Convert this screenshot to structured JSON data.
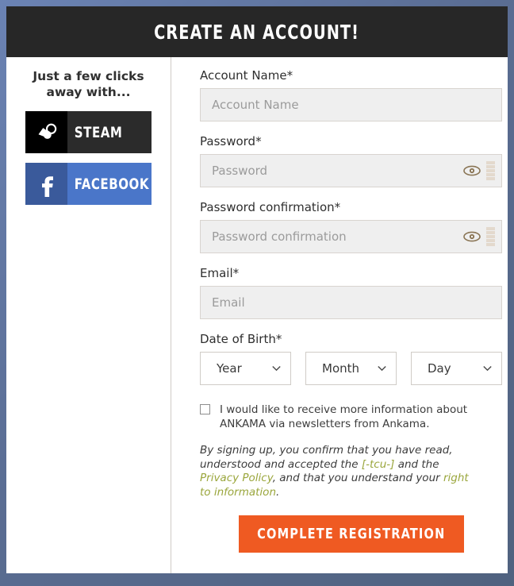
{
  "header": {
    "title": "CREATE AN ACCOUNT!"
  },
  "sidebar": {
    "heading": "Just a few clicks away with...",
    "buttons": [
      {
        "label": "STEAM",
        "icon": "steam-icon",
        "bg": "#2b2b2b",
        "icon_bg": "#000000"
      },
      {
        "label": "FACEBOOK",
        "icon": "facebook-icon",
        "bg": "#4a76c9",
        "icon_bg": "#3a5a9b"
      }
    ]
  },
  "form": {
    "account_name": {
      "label": "Account Name*",
      "placeholder": "Account Name",
      "value": ""
    },
    "password": {
      "label": "Password*",
      "placeholder": "Password",
      "value": "",
      "toggle_icon": "eye-icon",
      "strength_segments": 5
    },
    "password_confirmation": {
      "label": "Password confirmation*",
      "placeholder": "Password confirmation",
      "value": "",
      "toggle_icon": "eye-icon",
      "strength_segments": 5
    },
    "email": {
      "label": "Email*",
      "placeholder": "Email",
      "value": ""
    },
    "date_of_birth": {
      "label": "Date of Birth*",
      "year": {
        "selected": "Year",
        "options": [
          "Year"
        ]
      },
      "month": {
        "selected": "Month",
        "options": [
          "Month"
        ]
      },
      "day": {
        "selected": "Day",
        "options": [
          "Day"
        ]
      }
    },
    "newsletter": {
      "checked": false,
      "text": "I would like to receive more information about ANKAMA via newsletters from Ankama."
    },
    "terms": {
      "part1": "By signing up, you confirm that you have read, understood and accepted the ",
      "link1": "[-tcu-]",
      "part2": " and the ",
      "link2": "Privacy Policy",
      "part3": ", and that you understand your ",
      "link3": "right to information",
      "part4": ".",
      "link_color": "#9aa63c"
    },
    "submit": {
      "label": "COMPLETE REGISTRATION",
      "color": "#ef5a22"
    }
  },
  "theme": {
    "page_background": "#5d6f96",
    "header_background": "#272727",
    "input_background": "#efefef"
  }
}
